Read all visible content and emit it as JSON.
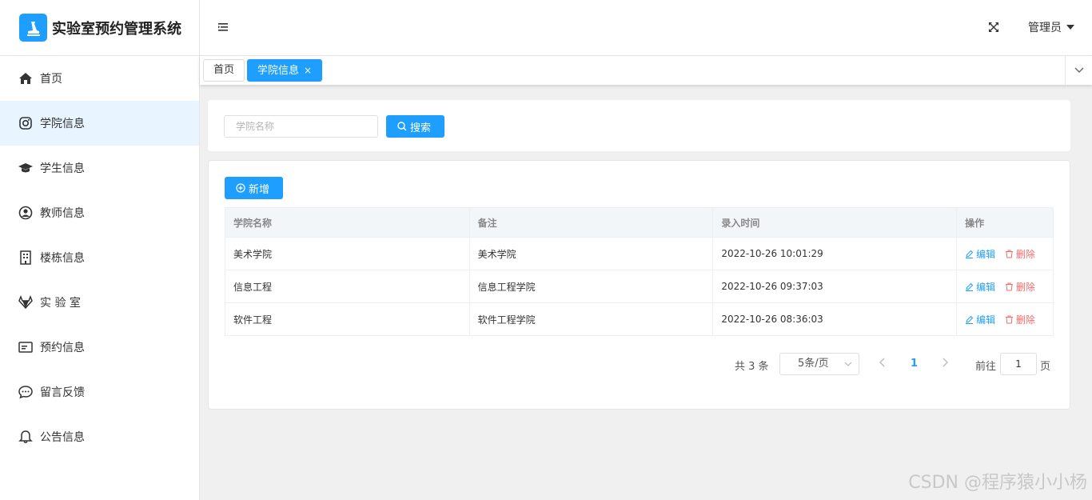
{
  "app": {
    "title": "实验室预约管理系统"
  },
  "sidebar": {
    "items": [
      {
        "label": "首页",
        "icon": "home-icon"
      },
      {
        "label": "学院信息",
        "icon": "instagram-icon"
      },
      {
        "label": "学生信息",
        "icon": "graduation-cap-icon"
      },
      {
        "label": "教师信息",
        "icon": "user-circle-icon"
      },
      {
        "label": "楼栋信息",
        "icon": "building-icon"
      },
      {
        "label": "实 验 室",
        "icon": "gitlab-icon"
      },
      {
        "label": "预约信息",
        "icon": "id-card-icon"
      },
      {
        "label": "留言反馈",
        "icon": "comment-icon"
      },
      {
        "label": "公告信息",
        "icon": "bell-icon"
      }
    ]
  },
  "header": {
    "user": "管理员"
  },
  "tabs": [
    {
      "label": "首页"
    },
    {
      "label": "学院信息",
      "close": "×"
    }
  ],
  "search": {
    "placeholder": "学院名称",
    "button": "搜索"
  },
  "toolbar": {
    "add": "新增"
  },
  "table": {
    "headers": [
      "学院名称",
      "备注",
      "录入时间",
      "操作"
    ],
    "rows": [
      {
        "name": "美术学院",
        "remark": "美术学院",
        "time": "2022-10-26 10:01:29"
      },
      {
        "name": "信息工程",
        "remark": "信息工程学院",
        "time": "2022-10-26 09:37:03"
      },
      {
        "name": "软件工程",
        "remark": "软件工程学院",
        "time": "2022-10-26 08:36:03"
      }
    ],
    "edit_label": "编辑",
    "delete_label": "删除"
  },
  "pagination": {
    "total": "共 3 条",
    "page_size": "5条/页",
    "current": "1",
    "goto_label": "前往",
    "goto_value": "1",
    "goto_suffix": "页"
  },
  "watermark": "CSDN @程序猿小小杨",
  "colors": {
    "primary": "#1e9fff",
    "danger": "#f56c6c",
    "active_bg": "#e8f4ff"
  }
}
